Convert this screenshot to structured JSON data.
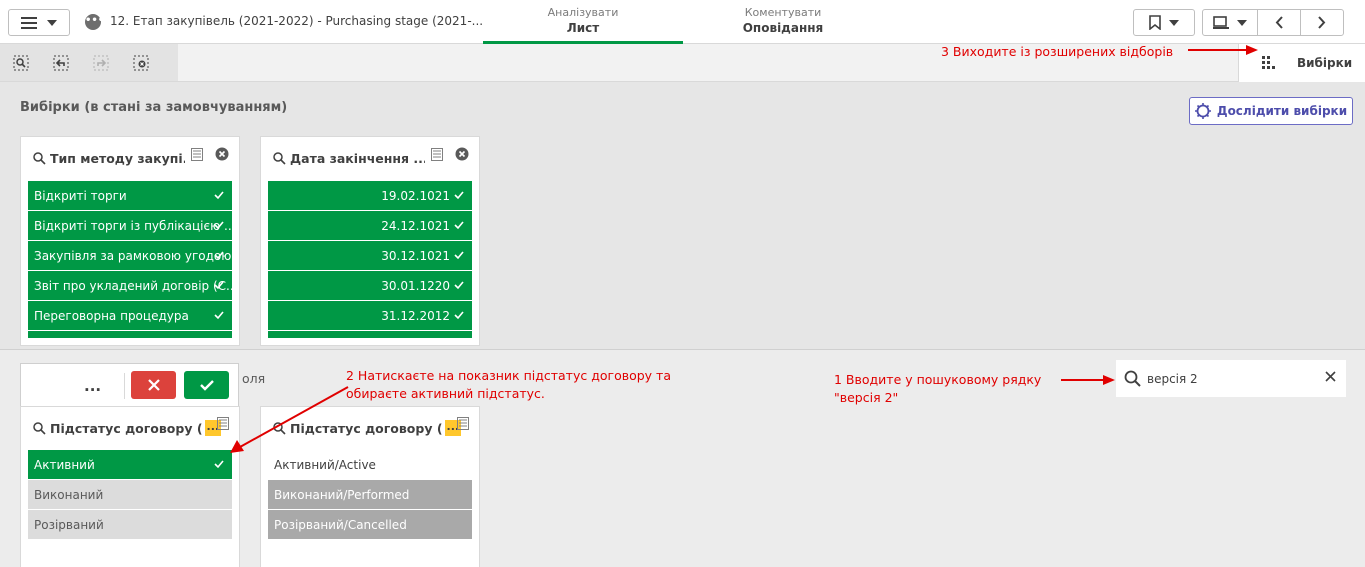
{
  "header": {
    "app_title": "12. Етап закупівель (2021-2022) - Purchasing stage (2021-...",
    "tabs": [
      {
        "small": "Аналізувати",
        "big": "Лист"
      },
      {
        "small": "Коментувати",
        "big": "Оповідання"
      }
    ]
  },
  "toolbar": {
    "selections_tab": "Вибірки"
  },
  "annotations": {
    "a3": "3 Виходите із розширених відборів",
    "a2_line1": "2 Натискаєте на показник підстатус договору та",
    "a2_line2": "обираєте активний підстатус.",
    "a1_line1": "1 Вводите у пошуковому рядку",
    "a1_line2": "\"версія 2\""
  },
  "selections": {
    "section_title": "Вибірки (в стані за замовчуванням)",
    "explore_button": "Дослідити вибірки",
    "card1": {
      "title": "Тип методу закупі...",
      "items": [
        "Відкриті торги",
        "Відкриті торги із публікацією ...",
        "Закупівля за рамковою угодою",
        "Звіт про укладений договір (С...",
        "Переговорна процедура"
      ]
    },
    "card2": {
      "title": "Дата закінчення ...",
      "items": [
        "19.02.1021",
        "24.12.1021",
        "30.12.1021",
        "30.01.1220",
        "31.12.2012"
      ]
    }
  },
  "lower": {
    "confirm_more": "...",
    "hidden_text": "оля",
    "card3": {
      "title": "Підстатус договору (",
      "badge": "...",
      "items": [
        "Активний",
        "Виконаний",
        "Розірваний"
      ]
    },
    "card4": {
      "title": "Підстатус договору (",
      "badge": "...",
      "items": [
        "Активний/Active",
        "Виконаний/Performed",
        "Розірваний/Cancelled"
      ]
    }
  },
  "search": {
    "value": "версія 2"
  }
}
